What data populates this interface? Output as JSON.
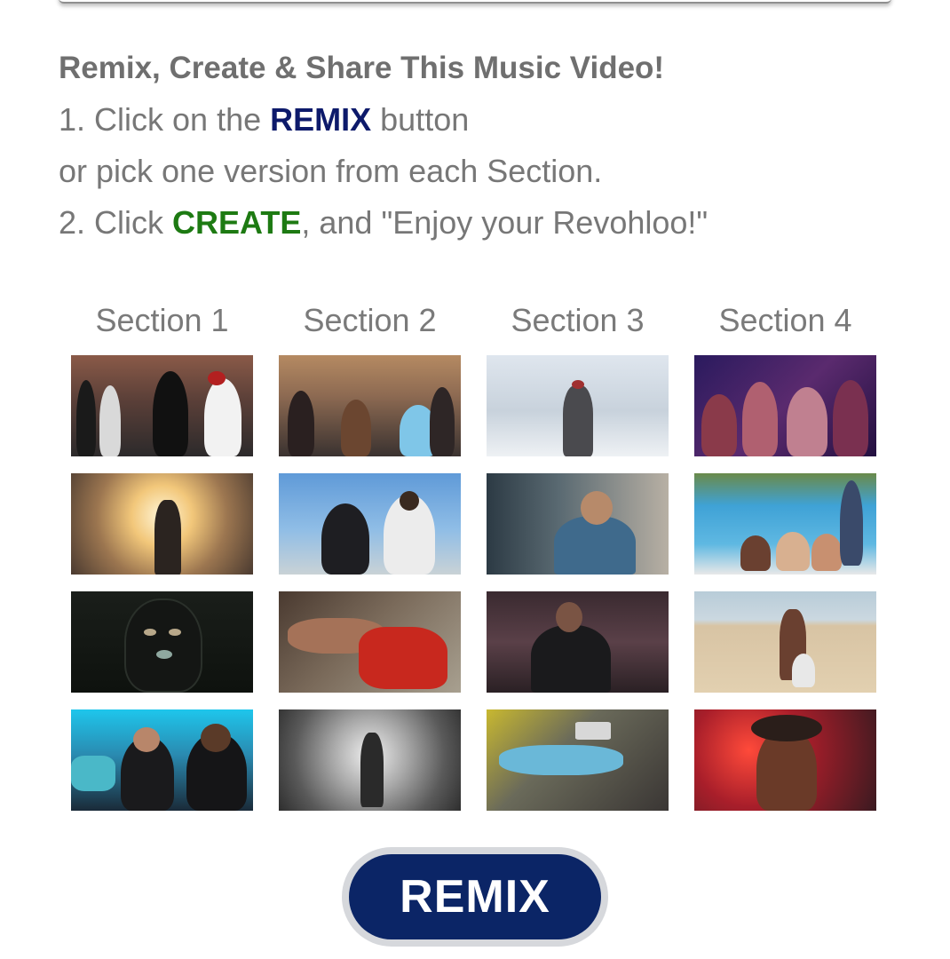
{
  "instructions": {
    "headline": "Remix, Create & Share This Music Video!",
    "step1_prefix": "1. Click on the ",
    "step1_keyword": "REMIX",
    "step1_suffix": " button",
    "step1_line2": "or pick one version from each Section.",
    "step2_prefix": "2. Click ",
    "step2_keyword": "CREATE",
    "step2_suffix": ", and \"Enjoy your Revohloo!\""
  },
  "sections": [
    {
      "label": "Section 1"
    },
    {
      "label": "Section 2"
    },
    {
      "label": "Section 3"
    },
    {
      "label": "Section 4"
    }
  ],
  "colors": {
    "remix_keyword": "#0d1a6b",
    "create_keyword": "#1d7a12",
    "remix_button": "#0b2566"
  },
  "remix_button": {
    "label": "REMIX"
  }
}
